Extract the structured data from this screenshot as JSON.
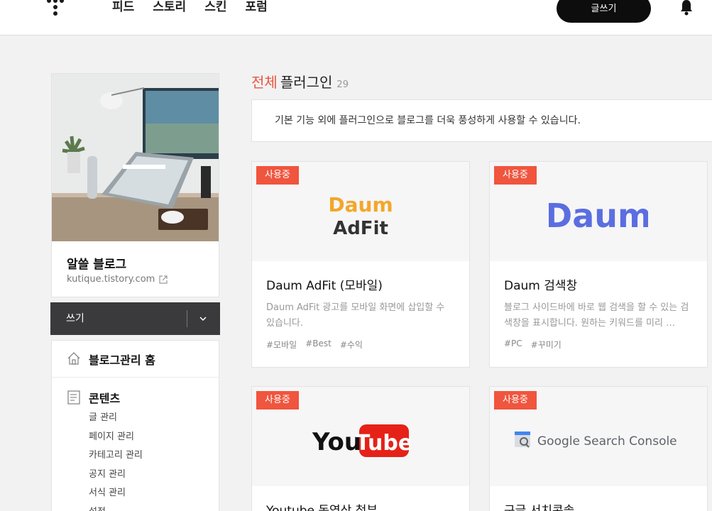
{
  "nav": {
    "items": [
      "피드",
      "스토리",
      "스킨",
      "포럼"
    ],
    "write_label": "글쓰기"
  },
  "profile": {
    "blog_name": "알쓸 블로그",
    "blog_url": "kutique.tistory.com"
  },
  "write_bar": {
    "label": "쓰기"
  },
  "menu": {
    "home_label": "블로그관리 홈",
    "contents_label": "콘텐츠",
    "contents_items": [
      "글 관리",
      "페이지 관리",
      "카테고리 관리",
      "공지 관리",
      "서식 관리",
      "설정"
    ]
  },
  "main": {
    "heading_accent": "전체",
    "heading_rest": "플러그인",
    "count": "29",
    "intro": "기본 기능 외에 플러그인으로 블로그를 더욱 풍성하게 사용할 수 있습니다."
  },
  "cards": [
    {
      "badge": "사용중",
      "logo_text_top": "Daum",
      "logo_text_bottom": "AdFit",
      "title": "Daum AdFit (모바일)",
      "desc": "Daum AdFit 광고를 모바일 화면에 삽입할 수 있습니다.",
      "tags": [
        "#모바일",
        "#Best",
        "#수익"
      ]
    },
    {
      "badge": "사용중",
      "logo_text": "Daum",
      "title": "Daum 검색창",
      "desc": "블로그 사이드바에 바로 웹 검색을 할 수 있는 검색창을 표시합니다. 원하는 키워드를 미리 …",
      "tags": [
        "#PC",
        "#꾸미기"
      ]
    },
    {
      "badge": "사용중",
      "logo_text_a": "You",
      "logo_text_b": "Tube",
      "title": "Youtube 동영상 첨부"
    },
    {
      "badge": "사용중",
      "logo_text": "Google Search Console",
      "title": "구글 서치콘솔"
    }
  ],
  "colors": {
    "accent": "#f0553e",
    "dark": "#0d0d0d",
    "write_bar": "#3a3a3c"
  }
}
